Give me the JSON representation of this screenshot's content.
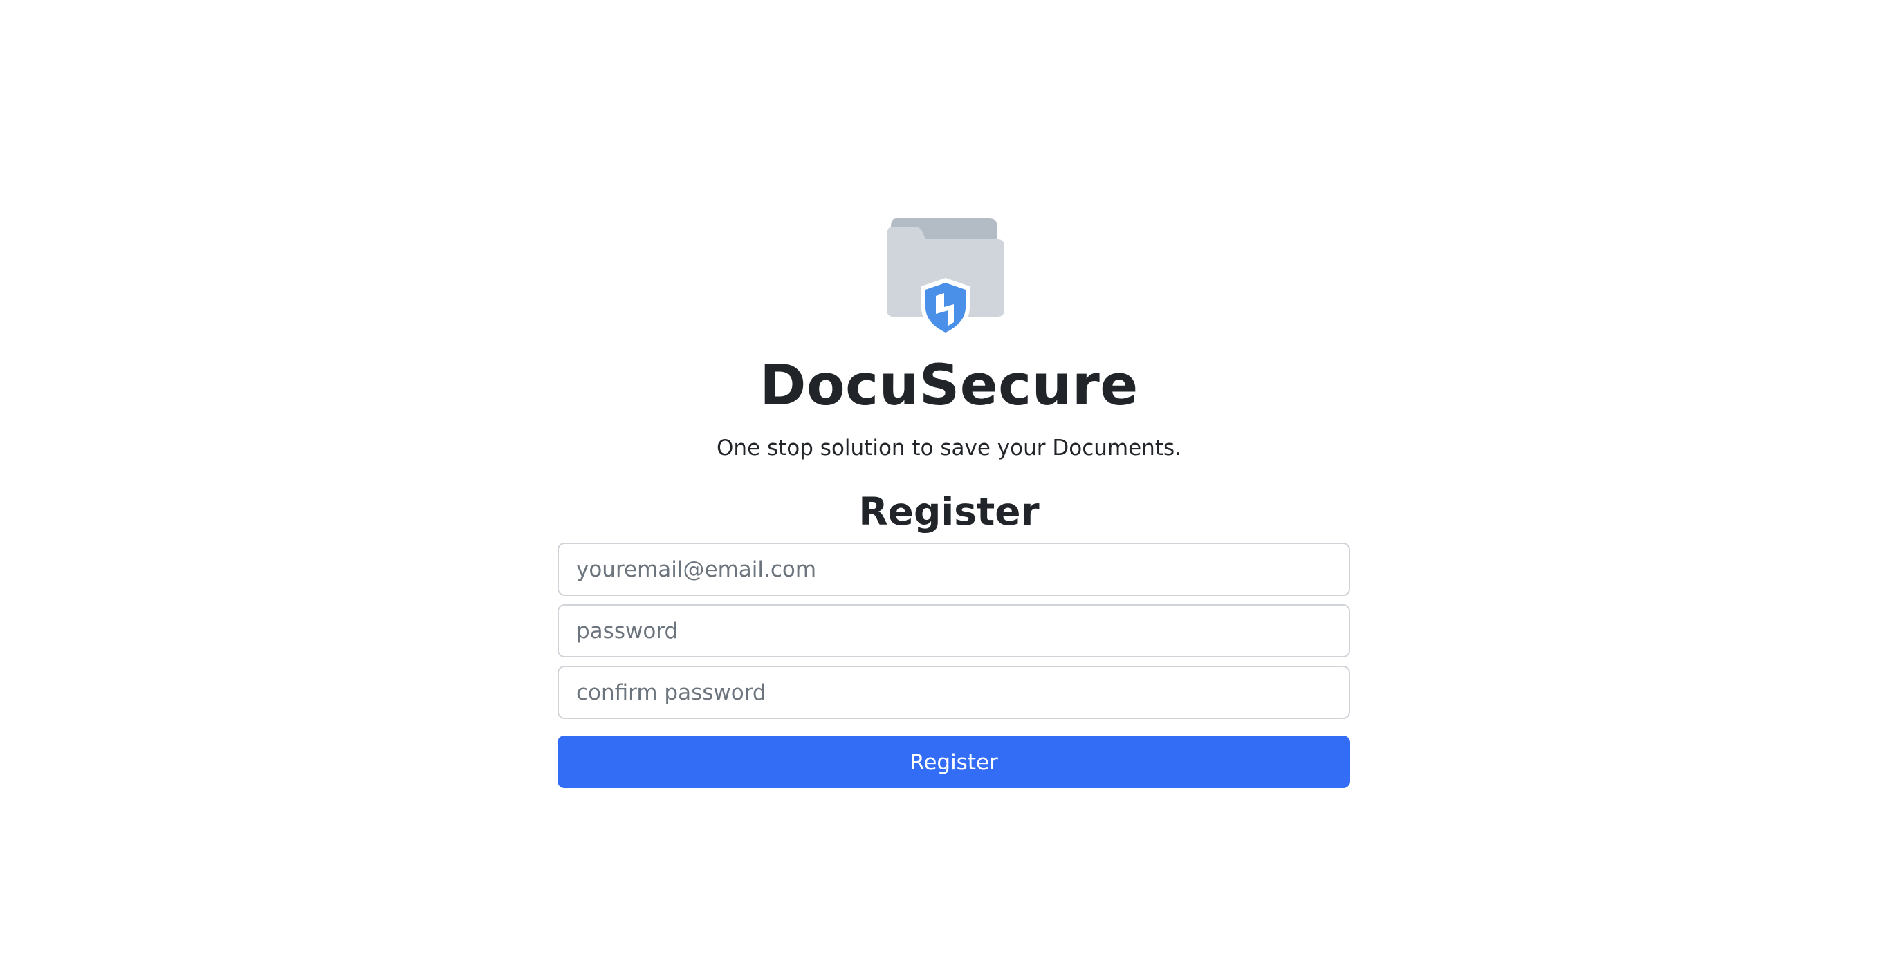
{
  "brand": {
    "name": "DocuSecure",
    "tagline": "One stop solution to save your Documents.",
    "logo_icon": "secure-folder-icon"
  },
  "register_form": {
    "heading": "Register",
    "email_placeholder": "youremail@email.com",
    "password_placeholder": "password",
    "confirm_password_placeholder": "confirm password",
    "submit_label": "Register"
  },
  "colors": {
    "primary_button": "#346df5",
    "shield": "#4a8fe8",
    "folder_back": "#b3bcc5",
    "folder_front": "#cfd5db",
    "text": "#212529"
  }
}
